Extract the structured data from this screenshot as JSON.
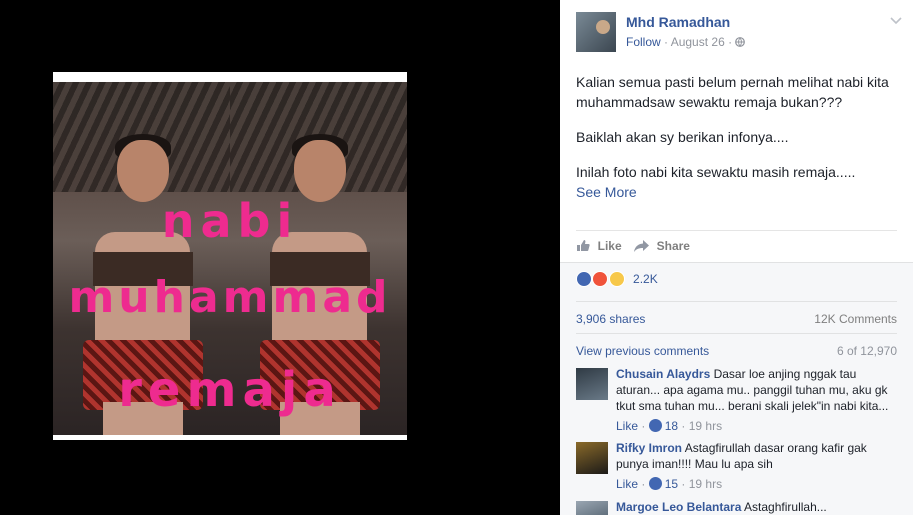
{
  "photo": {
    "overlay_line1": "nabi",
    "overlay_line2": "muhammad",
    "overlay_line3": "remaja"
  },
  "post": {
    "author": "Mhd Ramadhan",
    "follow_label": "Follow",
    "separator": "·",
    "date": "August 26",
    "privacy_icon": "globe-icon",
    "menu_icon": "chevron-down-icon",
    "paragraphs": [
      "Kalian semua pasti belum pernah melihat nabi kita muhammadsaw sewaktu remaja bukan???",
      "Baiklah akan sy berikan infonya....",
      "Inilah foto nabi kita sewaktu masih remaja....."
    ],
    "see_more": "See More"
  },
  "actions": {
    "like": "Like",
    "share": "Share"
  },
  "stats": {
    "reaction_icons": [
      "like-reaction-icon",
      "angry-reaction-icon",
      "haha-reaction-icon"
    ],
    "reaction_count": "2.2K",
    "shares": "3,906 shares",
    "comments": "12K Comments",
    "view_previous": "View previous comments",
    "comment_position": "6 of 12,970"
  },
  "comments": [
    {
      "name": "Chusain Alaydrs",
      "text": "Dasar loe anjing nggak tau aturan... apa agama mu.. panggil tuhan mu, aku gk tkut sma tuhan mu... berani skali jelek\"in nabi kita...",
      "like": "Like",
      "likes": "18",
      "time": "19 hrs"
    },
    {
      "name": "Rifky Imron",
      "text": "Astagfirullah dasar orang kafir gak punya iman!!!! Mau lu apa sih",
      "like": "Like",
      "likes": "15",
      "time": "19 hrs"
    },
    {
      "name": "Margoe Leo Belantara",
      "text": "Astaghfirullah..."
    }
  ],
  "colors": {
    "link": "#365899",
    "overlay_pink": "#ee2b8f",
    "viewer_bg": "#000000"
  }
}
